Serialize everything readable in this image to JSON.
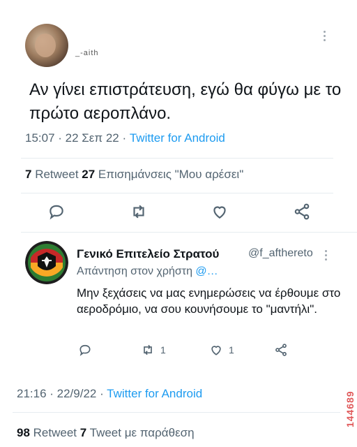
{
  "original_tweet": {
    "handle": "_-aith",
    "text": "Αν γίνει επιστράτευση, εγώ θα φύγω με το πρώτο αεροπλάνο.",
    "time": "15:07 · 22 Σεπ 22 · ",
    "client": "Twitter for Android",
    "retweets_count": "7",
    "retweets_label": " Retweet ",
    "likes_count": "27",
    "likes_label": " Επισημάνσεις \"Μου αρέσει\""
  },
  "reply_tweet": {
    "name": "Γενικό Επιτελείο Στρατού",
    "handle": "@f_afthereto",
    "replying_label": "Απάντηση στον χρήστη ",
    "replying_mention": "@…",
    "text": "Μην ξεχάσεις να μας ενημερώσεις να έρθουμε στο αεροδρόμιο, να σου κουνήσουμε το \"μαντήλι\".",
    "retweet_count": "1",
    "like_count": "1",
    "time": "21:16 · 22/9/22 · ",
    "client": "Twitter for Android",
    "retweets_count": "98",
    "retweets_label": " Retweet ",
    "quotes_count": "7",
    "quotes_label": " Tweet με παράθεση"
  },
  "watermark": "144689",
  "colors": {
    "link": "#1d9bf0",
    "muted": "#536471",
    "text": "#0f1419",
    "watermark": "#e0595a"
  },
  "icons": [
    "reply-icon",
    "retweet-icon",
    "like-icon",
    "share-icon",
    "more-icon"
  ]
}
